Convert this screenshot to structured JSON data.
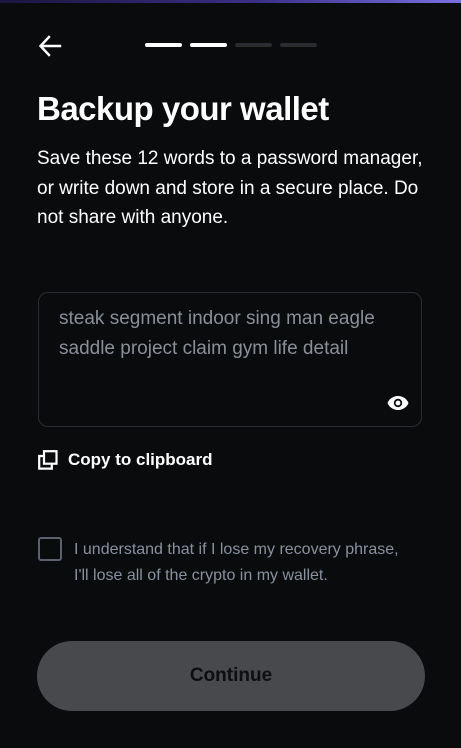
{
  "header": {
    "back_icon": "arrow-left-icon",
    "progress": {
      "total_steps": 4,
      "current_step": 2
    }
  },
  "content": {
    "title": "Backup your wallet",
    "subtitle": "Save these 12 words to a password manager, or write down and store in a secure place. Do not share with anyone."
  },
  "recovery_phrase": {
    "text": "steak segment indoor sing man eagle saddle project claim gym life detail",
    "visibility_icon": "eye-icon"
  },
  "copy": {
    "icon": "copy-icon",
    "label": "Copy to clipboard"
  },
  "consent": {
    "checked": false,
    "label": "I understand that if I lose my recovery phrase, I'll lose all of the crypto in my wallet."
  },
  "footer": {
    "continue_label": "Continue",
    "continue_disabled": true
  },
  "colors": {
    "background": "#0a0b0d",
    "text_primary": "#ffffff",
    "text_muted": "#8a8f98",
    "progress_active": "#ffffff",
    "progress_inactive": "#2a2c31",
    "button_disabled_bg": "#48494d",
    "accent_bar": "#3a2f86"
  }
}
